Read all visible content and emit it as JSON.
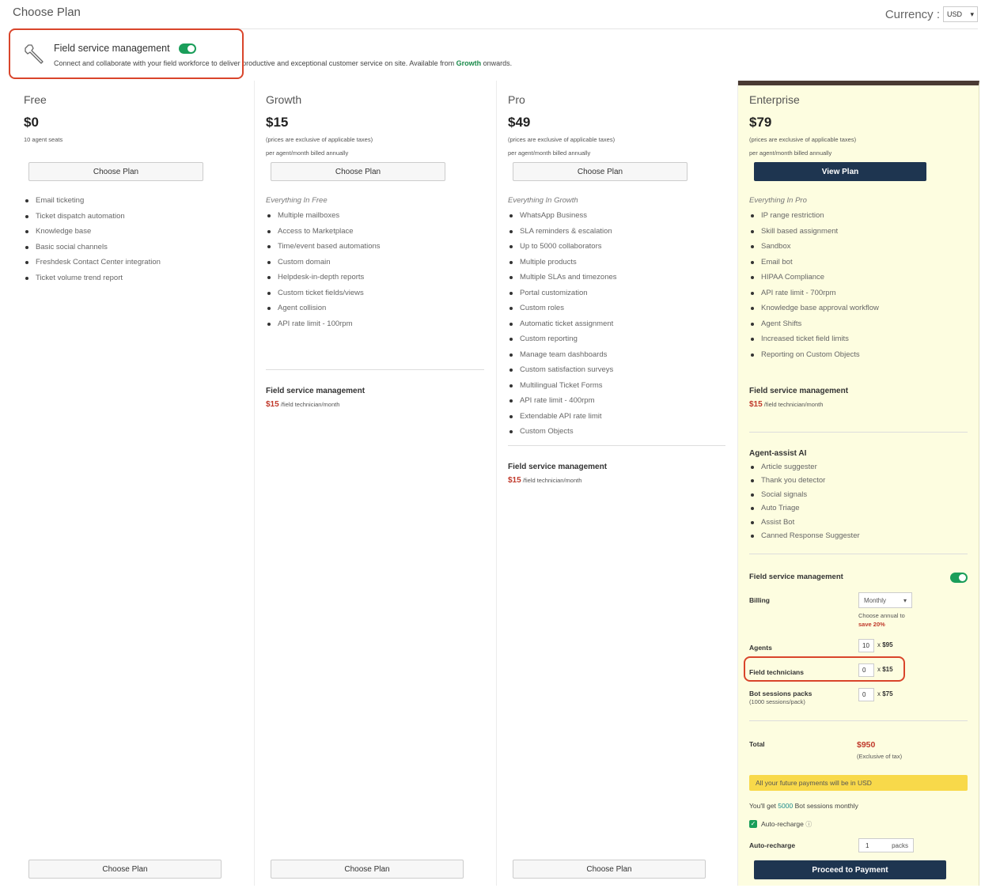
{
  "header": {
    "title": "Choose Plan",
    "currency_label": "Currency :",
    "currency_value": "USD"
  },
  "fsm_banner": {
    "title": "Field service management",
    "desc_prefix": "Connect and collaborate with your field workforce to deliver productive and exceptional customer service on site. Available from ",
    "desc_bold": "Growth",
    "desc_suffix": " onwards."
  },
  "plans": [
    {
      "name": "Free",
      "price": "$0",
      "note1": "10 agent seats",
      "button": "Choose Plan",
      "bottom_button": "Choose Plan",
      "features": [
        "Email ticketing",
        "Ticket dispatch automation",
        "Knowledge base",
        "Basic social channels",
        "Freshdesk Contact Center integration",
        "Ticket volume trend report"
      ]
    },
    {
      "name": "Growth",
      "price": "$15",
      "note1": "(prices are exclusive of applicable taxes)",
      "note2": "per agent/month billed annually",
      "button": "Choose Plan",
      "bottom_button": "Choose Plan",
      "everything": "Everything In Free",
      "features": [
        "Multiple mailboxes",
        "Access to Marketplace",
        "Time/event based automations",
        "Custom domain",
        "Helpdesk-in-depth reports",
        "Custom ticket fields/views",
        "Agent collision",
        "API rate limit - 100rpm"
      ],
      "fsm_title": "Field service management",
      "fsm_price": "$15",
      "fsm_unit": " /field technician/month"
    },
    {
      "name": "Pro",
      "price": "$49",
      "note1": "(prices are exclusive of applicable taxes)",
      "note2": "per agent/month billed annually",
      "button": "Choose Plan",
      "bottom_button": "Choose Plan",
      "everything": "Everything In Growth",
      "features": [
        "WhatsApp Business",
        "SLA reminders & escalation",
        "Up to 5000 collaborators",
        "Multiple products",
        "Multiple SLAs and timezones",
        "Portal customization",
        "Custom roles",
        "Automatic ticket assignment",
        "Custom reporting",
        "Manage team dashboards",
        "Custom satisfaction surveys",
        "Multilingual Ticket Forms",
        "API rate limit - 400rpm",
        "Extendable API rate limit",
        "Custom Objects"
      ],
      "fsm_title": "Field service management",
      "fsm_price": "$15",
      "fsm_unit": " /field technician/month"
    },
    {
      "name": "Enterprise",
      "price": "$79",
      "note1": "(prices are exclusive of applicable taxes)",
      "note2": "per agent/month billed annually",
      "button": "View Plan",
      "everything": "Everything In Pro",
      "features": [
        "IP range restriction",
        "Skill based assignment",
        "Sandbox",
        "Email bot",
        "HIPAA Compliance",
        "API rate limit - 700rpm",
        "Knowledge base approval workflow",
        "Agent Shifts",
        "Increased ticket field limits",
        "Reporting on Custom Objects"
      ],
      "fsm_title": "Field service management",
      "fsm_price": "$15",
      "fsm_unit": " /field technician/month",
      "ai_title": "Agent-assist AI",
      "ai_features": [
        "Article suggester",
        "Thank you detector",
        "Social signals",
        "Auto Triage",
        "Assist Bot",
        "Canned Response Suggester"
      ],
      "config": {
        "fsm_label": "Field service management",
        "billing_label": "Billing",
        "billing_value": "Monthly",
        "annual_note": "Choose annual to",
        "annual_save": "save 20%",
        "agents_label": "Agents",
        "agents_value": "10",
        "agents_price": "$95",
        "techs_label": "Field technicians",
        "techs_value": "0",
        "techs_price": "$15",
        "bots_label": "Bot sessions packs",
        "bots_sub": "(1000 sessions/pack)",
        "bots_value": "0",
        "bots_price": "$75",
        "mult": "x",
        "total_label": "Total",
        "total_value": "$950",
        "total_note": "(Exclusive of tax)",
        "notice": "All your future payments will be in USD",
        "sessions_prefix": "You'll get ",
        "sessions_count": "5000",
        "sessions_suffix": " Bot sessions monthly",
        "autorecharge_check": "Auto-recharge",
        "autorecharge_label": "Auto-recharge",
        "autorecharge_value": "1",
        "autorecharge_unit": "packs",
        "proceed": "Proceed to Payment"
      }
    }
  ]
}
